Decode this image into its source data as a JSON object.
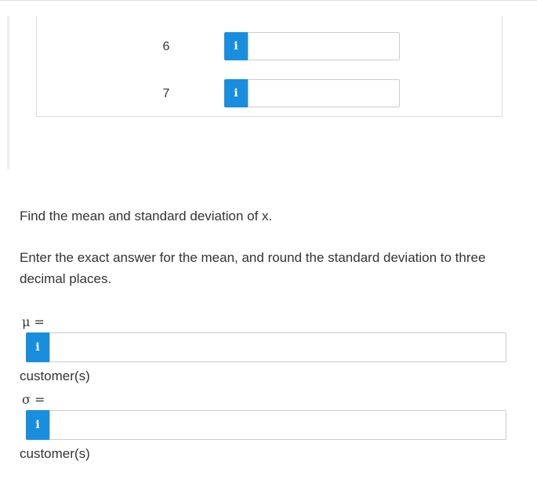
{
  "table": {
    "rows": [
      {
        "x": "6",
        "info_icon": "info-icon"
      },
      {
        "x": "7",
        "info_icon": "info-icon"
      }
    ]
  },
  "question": {
    "prompt": "Find the mean and standard deviation of x.",
    "instruction": "Enter the exact answer for the mean, and round the standard deviation to three decimal places."
  },
  "answers": {
    "mean_symbol": "μ =",
    "mean_unit": "customer(s)",
    "sd_symbol": "σ =",
    "sd_unit": "customer(s)",
    "info_glyph": "i"
  },
  "colors": {
    "accent": "#1a8ede",
    "border": "#cccccc",
    "text": "#333333"
  }
}
